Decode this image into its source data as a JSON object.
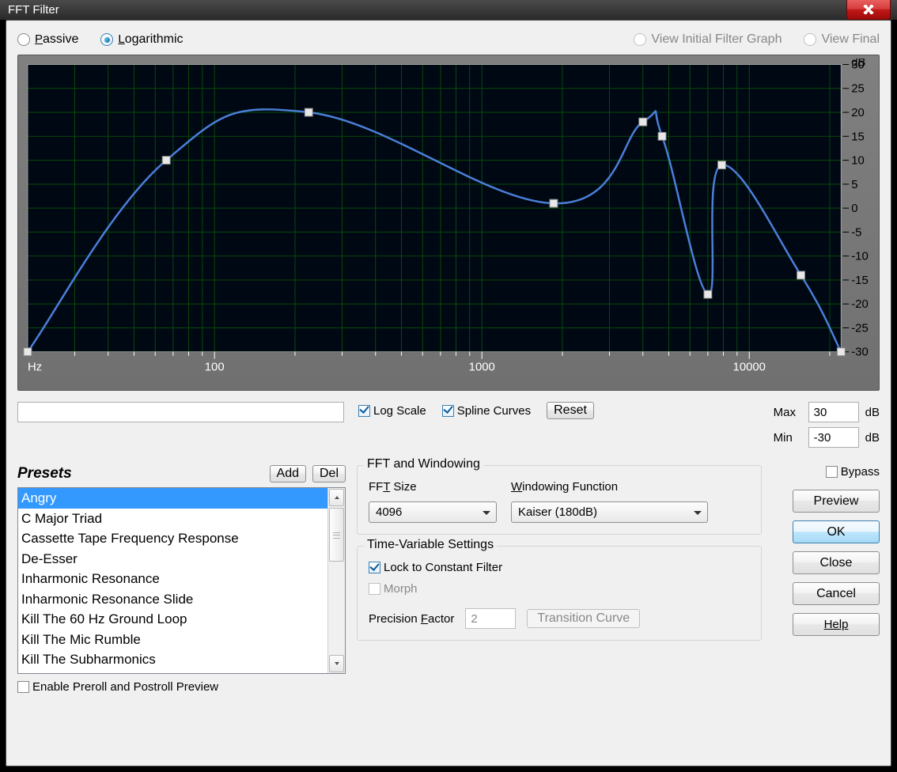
{
  "title": "FFT Filter",
  "radios": {
    "passive": "Passive",
    "passive_ul": "P",
    "log": "Logarithmic",
    "log_ul": "L",
    "vig": "View Initial Filter Graph",
    "vig_ul": "I",
    "vf": "View Final"
  },
  "axis": {
    "unit": "Hz",
    "db": "dB",
    "x": [
      100,
      1000,
      10000
    ],
    "y": [
      30,
      25,
      20,
      15,
      10,
      5,
      0,
      -5,
      -10,
      -15,
      -20,
      -25,
      -30
    ]
  },
  "checks": {
    "logscale": "Log Scale",
    "spline": "Spline Curves",
    "reset": "Reset",
    "max": "Max",
    "min": "Min",
    "db": "dB",
    "maxval": "30",
    "minval": "-30",
    "bypass": "Bypass"
  },
  "presets": {
    "title": "Presets",
    "add": "Add",
    "del": "Del",
    "items": [
      "Angry",
      "C Major Triad",
      "Cassette Tape Frequency Response",
      "De-Esser",
      "Inharmonic Resonance",
      "Inharmonic Resonance Slide",
      "Kill The 60 Hz Ground Loop",
      "Kill The Mic Rumble",
      "Kill The Subharmonics"
    ],
    "selected": 0,
    "preroll": "Enable Preroll and Postroll Preview"
  },
  "fft": {
    "legend": "FFT and Windowing",
    "size_lbl": "FFT Size",
    "size_val": "4096",
    "win_lbl": "Windowing Function",
    "win_val": "Kaiser (180dB)"
  },
  "tvar": {
    "legend": "Time-Variable Settings",
    "lock": "Lock to Constant Filter",
    "morph": "Morph",
    "pf": "Precision Factor",
    "pf_val": "2",
    "tc": "Transition Curve"
  },
  "rbtns": {
    "preview": "Preview",
    "ok": "OK",
    "close": "Close",
    "cancel": "Cancel",
    "help": "Help"
  },
  "chart_data": {
    "type": "line",
    "xscale": "log",
    "xrange": [
      20,
      22050
    ],
    "xlabel": "Hz",
    "yrange": [
      -30,
      30
    ],
    "ylabel": "dB",
    "grid": true,
    "control_points": [
      {
        "hz": 20,
        "db": -30
      },
      {
        "hz": 66,
        "db": 10
      },
      {
        "hz": 225,
        "db": 20
      },
      {
        "hz": 1855,
        "db": 1
      },
      {
        "hz": 4000,
        "db": 18
      },
      {
        "hz": 4720,
        "db": 15
      },
      {
        "hz": 7000,
        "db": -18
      },
      {
        "hz": 7890,
        "db": 9
      },
      {
        "hz": 15600,
        "db": -14
      },
      {
        "hz": 22050,
        "db": -30
      }
    ]
  }
}
